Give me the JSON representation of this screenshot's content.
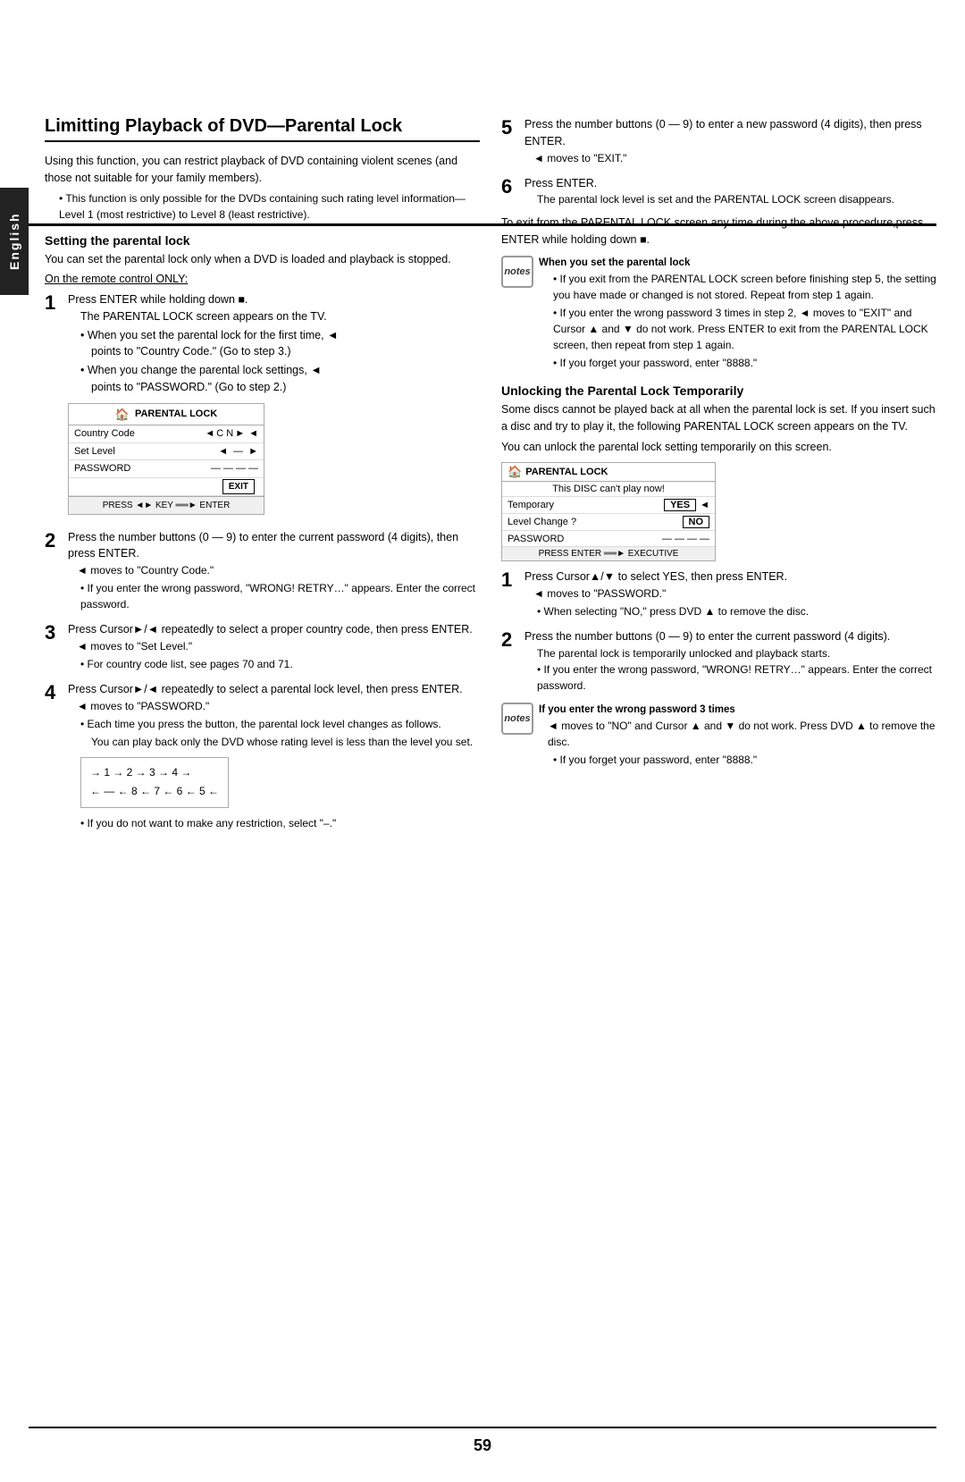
{
  "sidebar": {
    "label": "English"
  },
  "page": {
    "number": "59",
    "title": "Limitting Playback of DVD—Parental Lock",
    "intro1": "Using this function, you can restrict playback of DVD containing violent scenes (and those not suitable for your family members).",
    "intro_bullet": "This function is only possible for the DVDs containing such rating level information—Level 1 (most restrictive) to Level 8 (least restrictive).",
    "section1_heading": "Setting the parental lock",
    "section1_body": "You can set the parental lock only when a DVD is loaded and playback is stopped.",
    "remote_only": "On the remote control ONLY:",
    "step1_num": "1",
    "step1_text": "Press ENTER while holding down",
    "step1_sub1": "The PARENTAL LOCK screen appears on the TV.",
    "step1_bullet1": "When you set the parental lock for the first time,",
    "step1_bullet1b": "points to \"Country Code.\" (Go to step 3.)",
    "step1_bullet2": "When you change the parental lock settings,",
    "step1_bullet2b": "points to \"PASSWORD.\" (Go to step 2.)",
    "lock_box": {
      "title": "PARENTAL LOCK",
      "row1_label": "Country Code",
      "row1_value": "C N",
      "row2_label": "Set Level",
      "row2_value": "—",
      "row3_label": "PASSWORD",
      "row3_value": "— — — —",
      "exit_label": "EXIT",
      "footer": "PRESS ◄► KEY ══► ENTER"
    },
    "step2_num": "2",
    "step2_text": "Press the number buttons (0 — 9) to enter the current password (4 digits), then press ENTER.",
    "step2_arrow": "moves to \"Country Code.\"",
    "step2_bullet": "If you enter the wrong password, \"WRONG! RETRY…\" appears. Enter the correct password.",
    "step3_num": "3",
    "step3_text": "Press Cursor►/◄ repeatedly to select a proper country code, then press ENTER.",
    "step3_arrow": "moves to \"Set Level.\"",
    "step3_bullet": "For country code list, see pages 70 and 71.",
    "step4_num": "4",
    "step4_text": "Press Cursor►/◄ repeatedly to select a parental lock level, then press ENTER.",
    "step4_arrow": "moves to \"PASSWORD.\"",
    "step4_bullet1": "Each time you press the button, the parental lock level changes as follows.",
    "step4_sub": "You can play back only the DVD whose rating level is less than the level you set.",
    "level_row1": "1 → 2 → 3 → 4",
    "level_row2": "— ← 8 ← 7 ← 6 ← 5",
    "step4_bullet2": "If you do not want to make any restriction, select \"–.\"",
    "step5_num": "5",
    "step5_text": "Press the number buttons (0 — 9) to enter a new password (4 digits), then press ENTER.",
    "step5_arrow": "moves to \"EXIT.\"",
    "step6_num": "6",
    "step6_text": "Press ENTER.",
    "step6_sub": "The parental lock level is set and the PARENTAL LOCK screen disappears.",
    "exit_para": "To exit from the PARENTAL LOCK screen any time during the above procedure,press ENTER while holding down ■.",
    "notes1_heading": "When you set the parental lock",
    "notes1_bullet1": "If you exit from the PARENTAL LOCK screen before finishing step 5, the setting you have made or changed is not stored. Repeat from step 1 again.",
    "notes1_bullet2": "If you enter the wrong password 3 times in step 2, ◄ moves to \"EXIT\" and Cursor ▲ and ▼ do not work. Press ENTER to exit from the PARENTAL LOCK screen, then repeat from step 1 again.",
    "notes1_bullet3": "If you forget your password, enter \"8888.\"",
    "unlock_heading": "Unlocking the Parental Lock Temporarily",
    "unlock_body1": "Some discs cannot be played back at all when the parental lock is set. If you insert such a disc and try to play it, the following PARENTAL LOCK screen appears on the TV.",
    "unlock_body2": "You can unlock the parental lock setting temporarily on this screen.",
    "unlock_box": {
      "title": "PARENTAL LOCK",
      "subtitle": "This DISC can't play now!",
      "row1_label": "Temporary",
      "row1_value": "YES",
      "row2_label": "Level Change ?",
      "row2_value": "NO",
      "row3_label": "PASSWORD",
      "row3_value": "— — — —",
      "footer_text": "PRESS ENTER ══► EXECUTIVE"
    },
    "ustep1_num": "1",
    "ustep1_text": "Press Cursor▲/▼ to select YES, then press ENTER.",
    "ustep1_arrow1": "moves to \"PASSWORD.\"",
    "ustep1_bullet1": "When selecting \"NO,\" press DVD ▲ to remove the disc.",
    "ustep2_num": "2",
    "ustep2_text": "Press the number buttons (0 — 9) to enter the current password (4 digits).",
    "ustep2_sub": "The parental lock is temporarily unlocked and playback starts.",
    "ustep2_bullet": "If you enter the wrong password, \"WRONG! RETRY…\" appears. Enter the correct password.",
    "notes2_heading": "If you enter the wrong password 3 times",
    "notes2_arrow": "moves to \"NO\" and Cursor ▲ and ▼ do not work. Press DVD ▲ to remove the disc.",
    "notes2_bullet": "If you forget your password, enter \"8888.\""
  }
}
